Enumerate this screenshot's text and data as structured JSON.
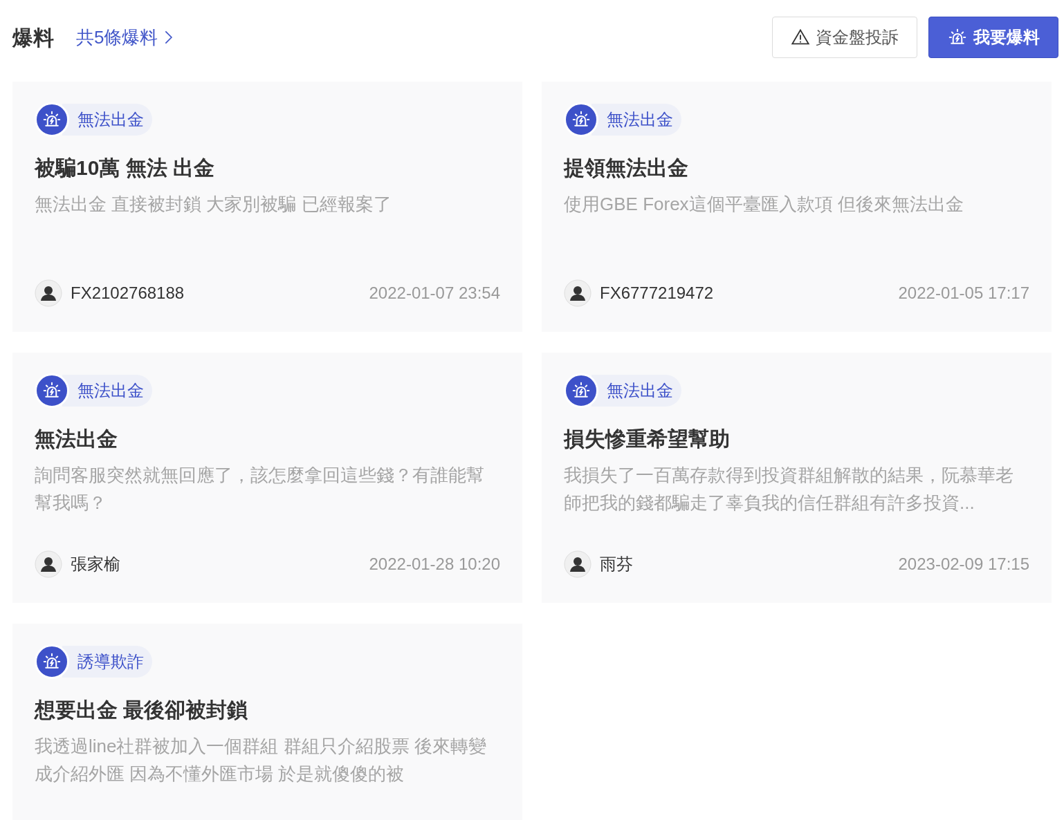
{
  "header": {
    "title": "爆料",
    "count_link": "共5條爆料",
    "buttons": [
      {
        "label": "資金盤投訴",
        "kind": "outline"
      },
      {
        "label": "我要爆料",
        "kind": "primary"
      }
    ]
  },
  "posts": [
    {
      "tag": "無法出金",
      "title": "被騙10萬 無法 出金",
      "description": "無法出金 直接被封鎖 大家別被騙 已經報案了",
      "user": "FX2102768188",
      "time": "2022-01-07 23:54"
    },
    {
      "tag": "無法出金",
      "title": "提領無法出金",
      "description": "使用GBE Forex這個平臺匯入款項 但後來無法出金",
      "user": "FX6777219472",
      "time": "2022-01-05 17:17"
    },
    {
      "tag": "無法出金",
      "title": "無法出金",
      "description": "詢問客服突然就無回應了，該怎麼拿回這些錢？有誰能幫幫我嗎？",
      "user": "張家榆",
      "time": "2022-01-28 10:20"
    },
    {
      "tag": "無法出金",
      "title": "損失慘重希望幫助",
      "description": "我損失了一百萬存款得到投資群組解散的結果，阮慕華老師把我的錢都騙走了辜負我的信任群組有許多投資...",
      "user": "雨芬",
      "time": "2023-02-09 17:15"
    },
    {
      "tag": "誘導欺詐",
      "title": "想要出金 最後卻被封鎖",
      "description": "我透過line社群被加入一個群組 群組只介紹股票 後來轉變成介紹外匯 因為不懂外匯市場 於是就傻傻的被"
    }
  ]
}
